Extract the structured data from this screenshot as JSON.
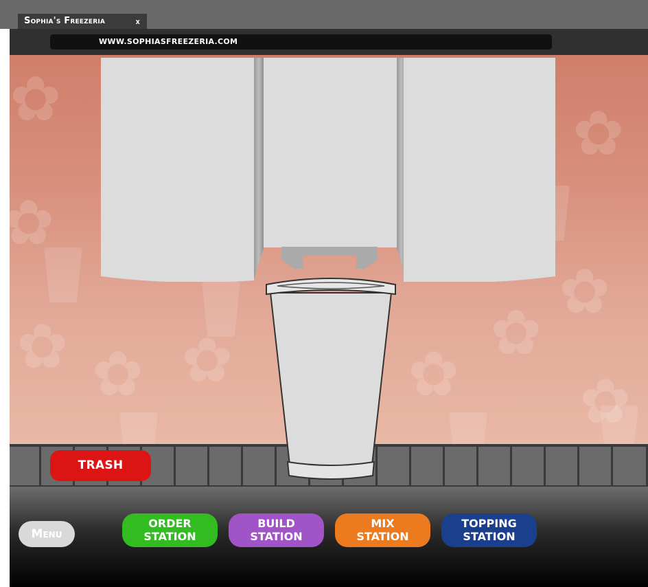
{
  "browser": {
    "tab_title": "Sophia's Freezeria",
    "tab_close": "x",
    "address": "WWW.SOPHIASFREEZERIA.COM"
  },
  "controls": {
    "trash_label": "TRASH",
    "menu_label": "Menu"
  },
  "stations": [
    {
      "line1": "ORDER",
      "line2": "STATION"
    },
    {
      "line1": "BUILD",
      "line2": "STATION"
    },
    {
      "line1": "MIX",
      "line2": "STATION"
    },
    {
      "line1": "TOPPING",
      "line2": "STATION"
    }
  ],
  "colors": {
    "trash": "#dc1414",
    "order_station": "#33bb22",
    "build_station": "#a153c8",
    "mix_station": "#ec7a1f",
    "topping_station": "#1a3f8c",
    "background_wall": "#d8917e"
  },
  "icons": {
    "background_pattern": "flower-icon",
    "background_cups": "cup-icon",
    "cup": "empty-cup"
  }
}
